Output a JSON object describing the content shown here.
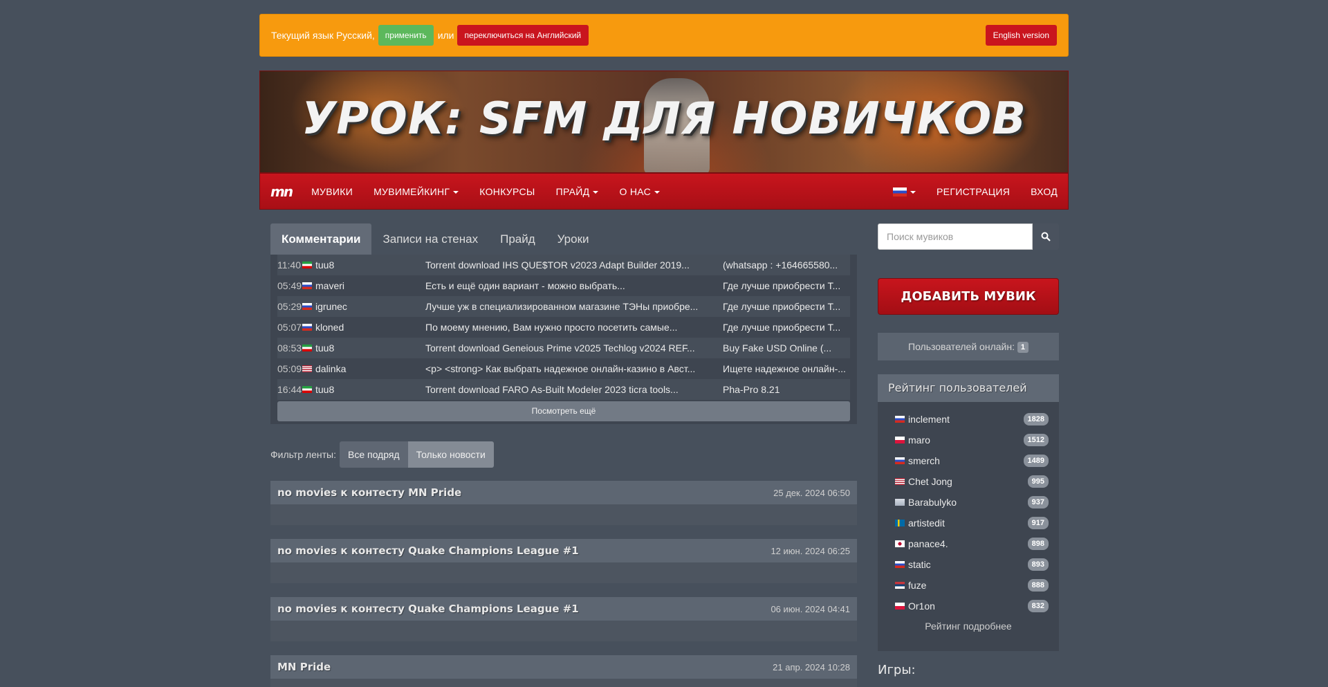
{
  "langbar": {
    "text": "Текущий язык Русский,",
    "apply": "применить",
    "or": "или",
    "switch": "переключиться на Английский",
    "english": "English version"
  },
  "banner": {
    "title": "УРОК: SFM ДЛЯ НОВИЧКОВ"
  },
  "nav": {
    "logo": "mn",
    "items": [
      "МУВИКИ",
      "МУВИМЕЙКИНГ",
      "КОНКУРСЫ",
      "ПРАЙД",
      "О НАС"
    ],
    "register": "РЕГИСТРАЦИЯ",
    "login": "ВХОД"
  },
  "tabs": [
    "Комментарии",
    "Записи на стенах",
    "Прайд",
    "Уроки"
  ],
  "comments": [
    {
      "time": "11:40",
      "user": "tuu8",
      "flag": "ir",
      "text": "Torrent download IHS QUE$TOR v2023 Adapt Builder 2019...",
      "title": "(whatsapp : +164665580..."
    },
    {
      "time": "05:49",
      "user": "maveri",
      "flag": "ru",
      "text": "Есть и ещё один вариант - можно выбрать...",
      "title": "Где лучше приобрести Т..."
    },
    {
      "time": "05:29",
      "user": "igrunec",
      "flag": "ru",
      "text": "Лучше уж в специализированном магазине ТЭНы приобре...",
      "title": "Где лучше приобрести Т..."
    },
    {
      "time": "05:07",
      "user": "kloned",
      "flag": "ru",
      "text": "По моему мнению, Вам нужно просто посетить самые...",
      "title": "Где лучше приобрести Т..."
    },
    {
      "time": "08:53",
      "user": "tuu8",
      "flag": "ir",
      "text": "Torrent download Geneious Prime v2025 Techlog v2024 REF...",
      "title": "Buy Fake USD Online (..."
    },
    {
      "time": "05:09",
      "user": "dalinka",
      "flag": "us",
      "text": "<p> <strong> Как выбрать надежное онлайн-казино в Авст...",
      "title": "Ищете надежное онлайн-..."
    },
    {
      "time": "16:44",
      "user": "tuu8",
      "flag": "ir",
      "text": "Torrent download FARO As-Built Modeler 2023 ticra tools...",
      "title": "Pha-Pro 8.21"
    }
  ],
  "more": "Посмотреть ещё",
  "filter": {
    "label": "Фильтр ленты:",
    "all": "Все подряд",
    "news": "Только новости"
  },
  "news": [
    {
      "title": "no movies к контесту MN Pride",
      "date": "25 дек. 2024 06:50"
    },
    {
      "title": "no movies к контесту Quake Champions League #1",
      "date": "12 июн. 2024 06:25"
    },
    {
      "title": "no movies к контесту Quake Champions League #1",
      "date": "06 июн. 2024 04:41"
    },
    {
      "title": "MN Pride",
      "date": "21 апр. 2024 10:28"
    }
  ],
  "search": {
    "placeholder": "Поиск мувиков"
  },
  "add_movie": "ДОБАВИТЬ МУВИК",
  "online": {
    "label": "Пользователей онлайн:",
    "count": "1"
  },
  "rating": {
    "title": "Рейтинг пользователей",
    "users": [
      {
        "name": "inclement",
        "flag": "ru",
        "score": "1828"
      },
      {
        "name": "maro",
        "flag": "pl",
        "score": "1512"
      },
      {
        "name": "smerch",
        "flag": "ru",
        "score": "1489"
      },
      {
        "name": "Chet Jong",
        "flag": "us",
        "score": "995"
      },
      {
        "name": "Barabulyko",
        "flag": "unknown",
        "score": "937"
      },
      {
        "name": "artistedit",
        "flag": "se",
        "score": "917"
      },
      {
        "name": "panace4.",
        "flag": "jp",
        "score": "898"
      },
      {
        "name": "static",
        "flag": "ru",
        "score": "893"
      },
      {
        "name": "fuze",
        "flag": "rs",
        "score": "888"
      },
      {
        "name": "Or1on",
        "flag": "pl",
        "score": "832"
      }
    ],
    "more": "Рейтинг подробнее"
  },
  "games_title": "Игры:",
  "colors": {
    "accent": "#c9151e",
    "langbar": "#f79a0e",
    "apply": "#5cb85c",
    "bg": "#47505c"
  }
}
